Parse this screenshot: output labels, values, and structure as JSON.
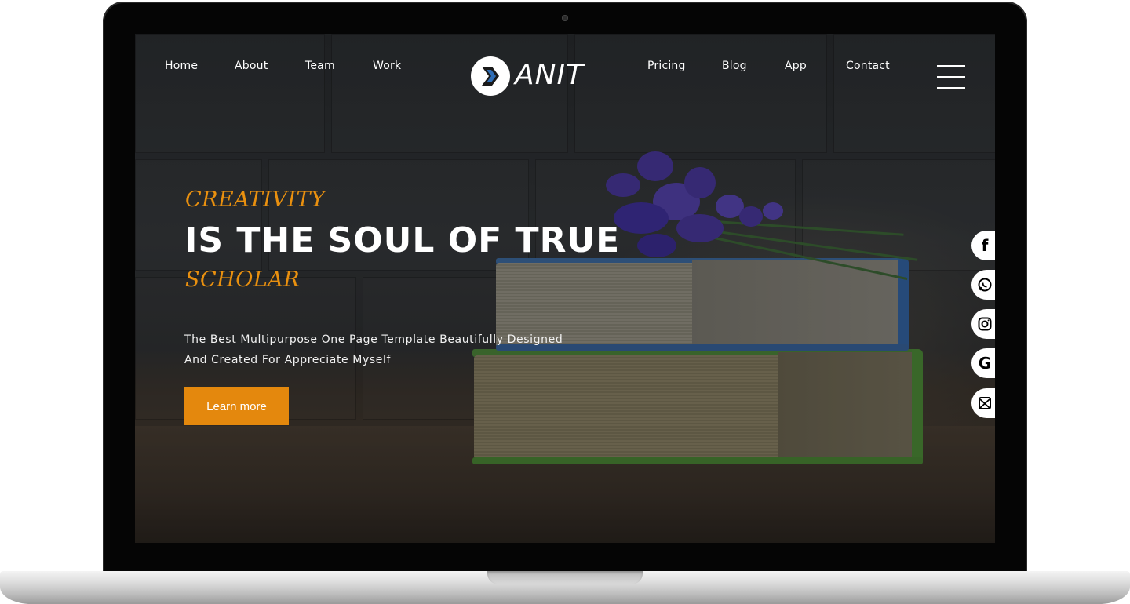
{
  "nav": {
    "left": [
      "Home",
      "About",
      "Team",
      "Work"
    ],
    "right": [
      "Pricing",
      "Blog",
      "App",
      "Contact"
    ]
  },
  "brand": {
    "name": "ANIT"
  },
  "hero": {
    "eyebrow": "CREATIVITY",
    "headline": "IS THE SOUL OF TRUE",
    "subhead": "SCHOLAR",
    "description_line1": "The Best Multipurpose One Page Template Beautifully Designed",
    "description_line2": "And Created For Appreciate Myself",
    "cta_label": "Learn more"
  },
  "social": [
    "facebook-icon",
    "whatsapp-icon",
    "instagram-icon",
    "google-icon",
    "mail-icon"
  ],
  "colors": {
    "accent": "#e4880d",
    "text": "#ffffff",
    "device": "#050505"
  }
}
